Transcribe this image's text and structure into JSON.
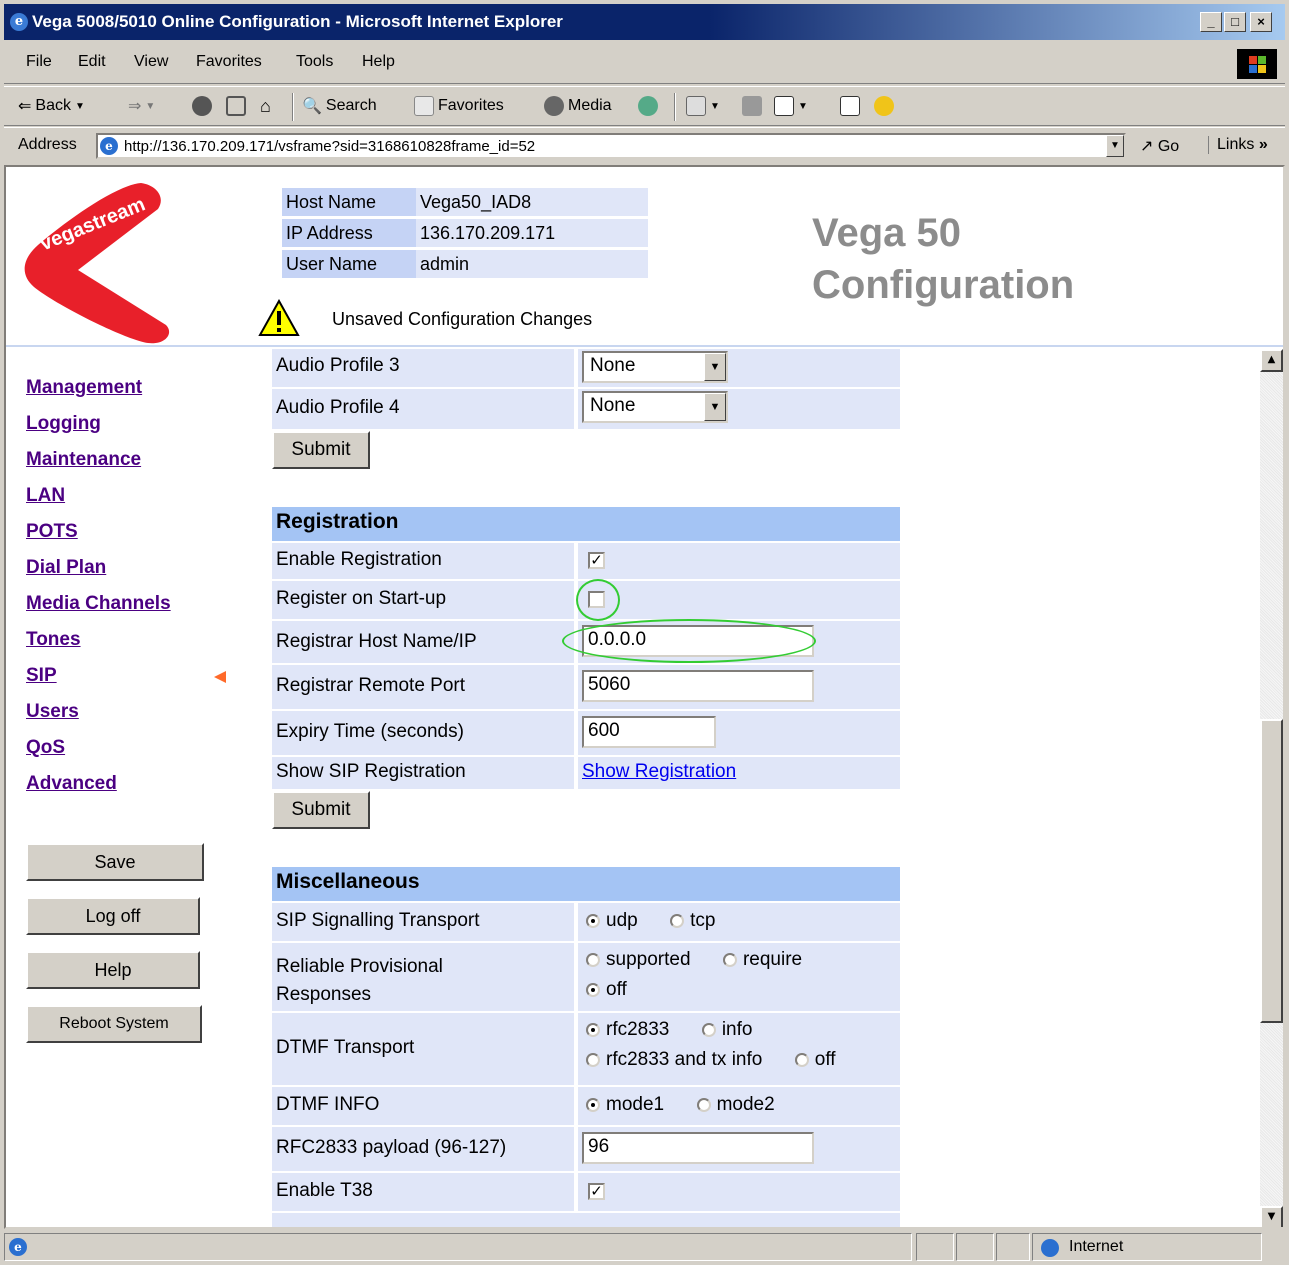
{
  "window": {
    "title": "Vega 5008/5010 Online Configuration - Microsoft Internet Explorer",
    "min": "_",
    "max": "□",
    "close": "×"
  },
  "menu": [
    "File",
    "Edit",
    "View",
    "Favorites",
    "Tools",
    "Help"
  ],
  "toolbar": {
    "back": "Back",
    "search": "Search",
    "favorites": "Favorites",
    "media": "Media"
  },
  "address": {
    "label": "Address",
    "url": "http://136.170.209.171/vsframe?sid=3168610828frame_id=52",
    "go": "Go",
    "links": "Links"
  },
  "header": {
    "host_name_label": "Host Name",
    "host_name": "Vega50_IAD8",
    "ip_label": "IP Address",
    "ip": "136.170.209.171",
    "user_label": "User Name",
    "user": "admin",
    "warning": "Unsaved Configuration Changes",
    "title_line1": "Vega 50",
    "title_line2": "Configuration",
    "logo_text": "vegastream"
  },
  "nav": {
    "links": [
      "Management",
      "Logging",
      "Maintenance",
      "LAN",
      "POTS",
      "Dial Plan",
      "Media Channels",
      "Tones",
      "SIP",
      "Users",
      "QoS",
      "Advanced"
    ],
    "active": "SIP",
    "buttons": [
      "Save",
      "Log off",
      "Help",
      "Reboot System"
    ]
  },
  "audio": {
    "profile3_label": "Audio Profile 3",
    "profile3_value": "None",
    "profile4_label": "Audio Profile 4",
    "profile4_value": "None",
    "submit": "Submit"
  },
  "registration": {
    "header": "Registration",
    "enable_label": "Enable Registration",
    "enable": true,
    "startup_label": "Register on Start-up",
    "startup": false,
    "host_label": "Registrar Host Name/IP",
    "host": "0.0.0.0",
    "port_label": "Registrar Remote Port",
    "port": "5060",
    "expiry_label": "Expiry Time (seconds)",
    "expiry": "600",
    "show_label": "Show SIP Registration",
    "show_link": "Show Registration",
    "submit": "Submit",
    "highlight_color": "#33cc33"
  },
  "misc": {
    "header": "Miscellaneous",
    "transport_label": "SIP Signalling Transport",
    "transport_udp": "udp",
    "transport_tcp": "tcp",
    "reliable_label_1": "Reliable Provisional",
    "reliable_label_2": "Responses",
    "rel_supported": "supported",
    "rel_require": "require",
    "rel_off": "off",
    "dtmf_label": "DTMF Transport",
    "dtmf_rfc": "rfc2833",
    "dtmf_info": "info",
    "dtmf_rfc_tx": "rfc2833 and tx info",
    "dtmf_off": "off",
    "dtmfinfo_label": "DTMF INFO",
    "mode1": "mode1",
    "mode2": "mode2",
    "rfc_payload_label": "RFC2833 payload (96-127)",
    "rfc_payload": "96",
    "t38_label": "Enable T38"
  },
  "status": {
    "zone": "Internet"
  }
}
